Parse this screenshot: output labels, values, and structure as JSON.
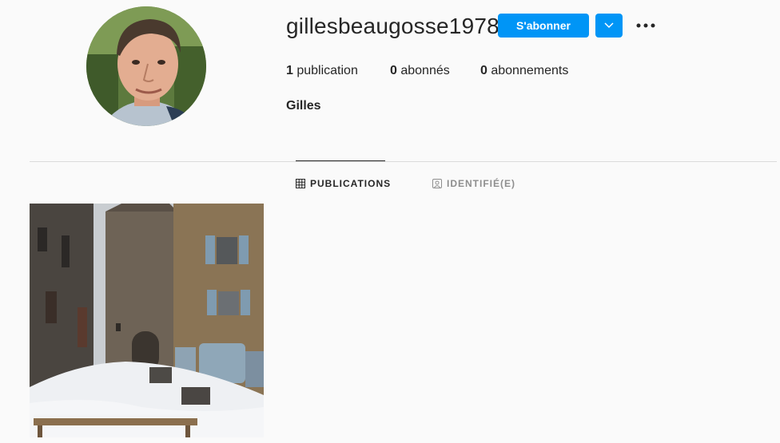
{
  "profile": {
    "username": "gillesbeaugosse1978",
    "follow_label": "S'abonner",
    "full_name": "Gilles",
    "avatar_icon": "profile-photo",
    "dropdown_icon": "chevron-down-icon",
    "more_icon": "more-options-icon"
  },
  "stats": {
    "posts_count": "1",
    "posts_label": " publication",
    "followers_count": "0",
    "followers_label": " abonnés",
    "following_count": "0",
    "following_label": " abonnements"
  },
  "tabs": [
    {
      "label": "PUBLICATIONS",
      "icon": "grid-icon",
      "active": true
    },
    {
      "label": "IDENTIFIÉ(E)",
      "icon": "tagged-icon",
      "active": false
    }
  ],
  "posts": [
    {
      "alt": "photo"
    }
  ],
  "colors": {
    "accent": "#0095f6",
    "text": "#262626",
    "muted": "#8e8e8e",
    "background": "#fafafa",
    "divider": "#dbdbdb"
  }
}
